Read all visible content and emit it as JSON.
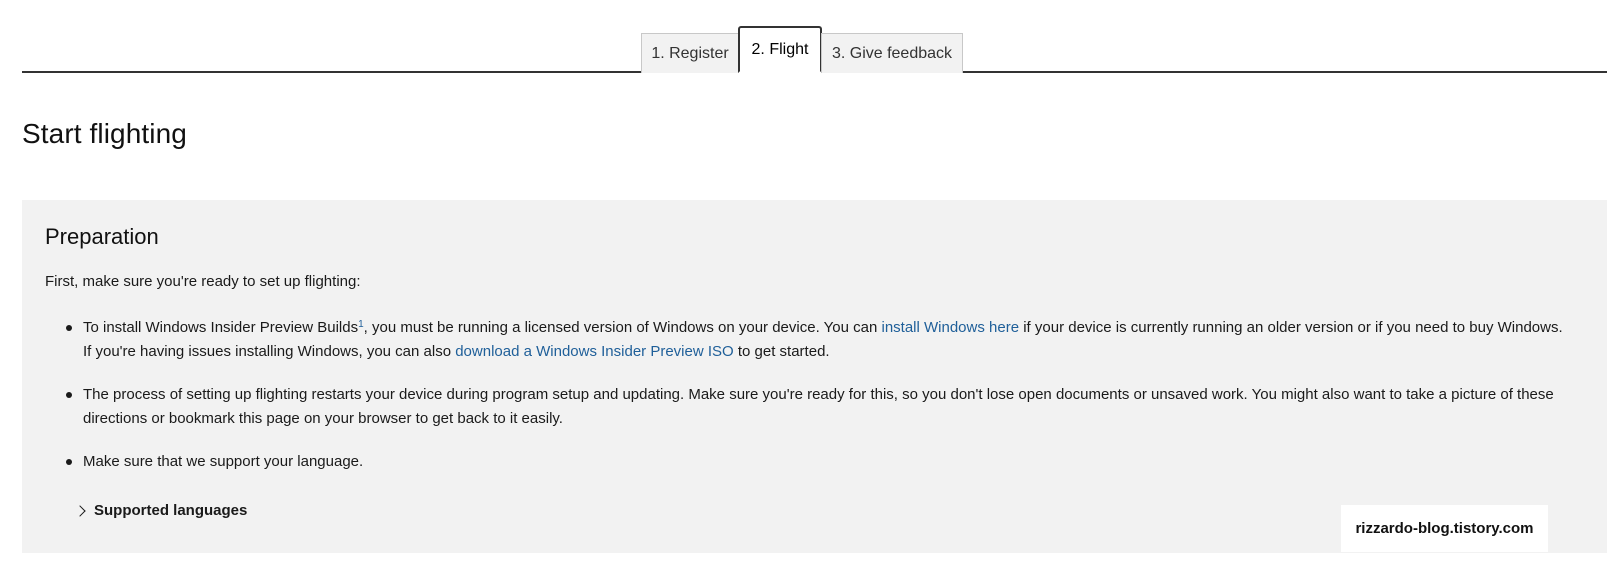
{
  "tabs": [
    {
      "label": "1. Register"
    },
    {
      "label": "2. Flight"
    },
    {
      "label": "3. Give feedback"
    }
  ],
  "title": "Start flighting",
  "preparation": {
    "heading": "Preparation",
    "intro": "First, make sure you're ready to set up flighting:",
    "bullet1": {
      "text_a": "To install Windows Insider Preview Builds",
      "sup": "1",
      "text_b": ", you must be running a licensed version of Windows on your device. You can ",
      "link1": "install Windows here",
      "text_c": " if your device is currently running an older version or if you need to buy Windows. If you're having issues installing Windows, you can also ",
      "link2": "download a Windows Insider Preview ISO",
      "text_d": " to get started."
    },
    "bullet2": "The process of setting up flighting restarts your device during program setup and updating. Make sure you're ready for this, so you don't lose open documents or unsaved work. You might also want to take a picture of these directions or bookmark this page on your browser to get back to it easily.",
    "bullet3": "Make sure that we support your language.",
    "expander_label": "Supported languages"
  },
  "watermark": "rizzardo-blog.tistory.com",
  "colors": {
    "link": "#1f5f99",
    "panel": "#f2f2f2"
  }
}
